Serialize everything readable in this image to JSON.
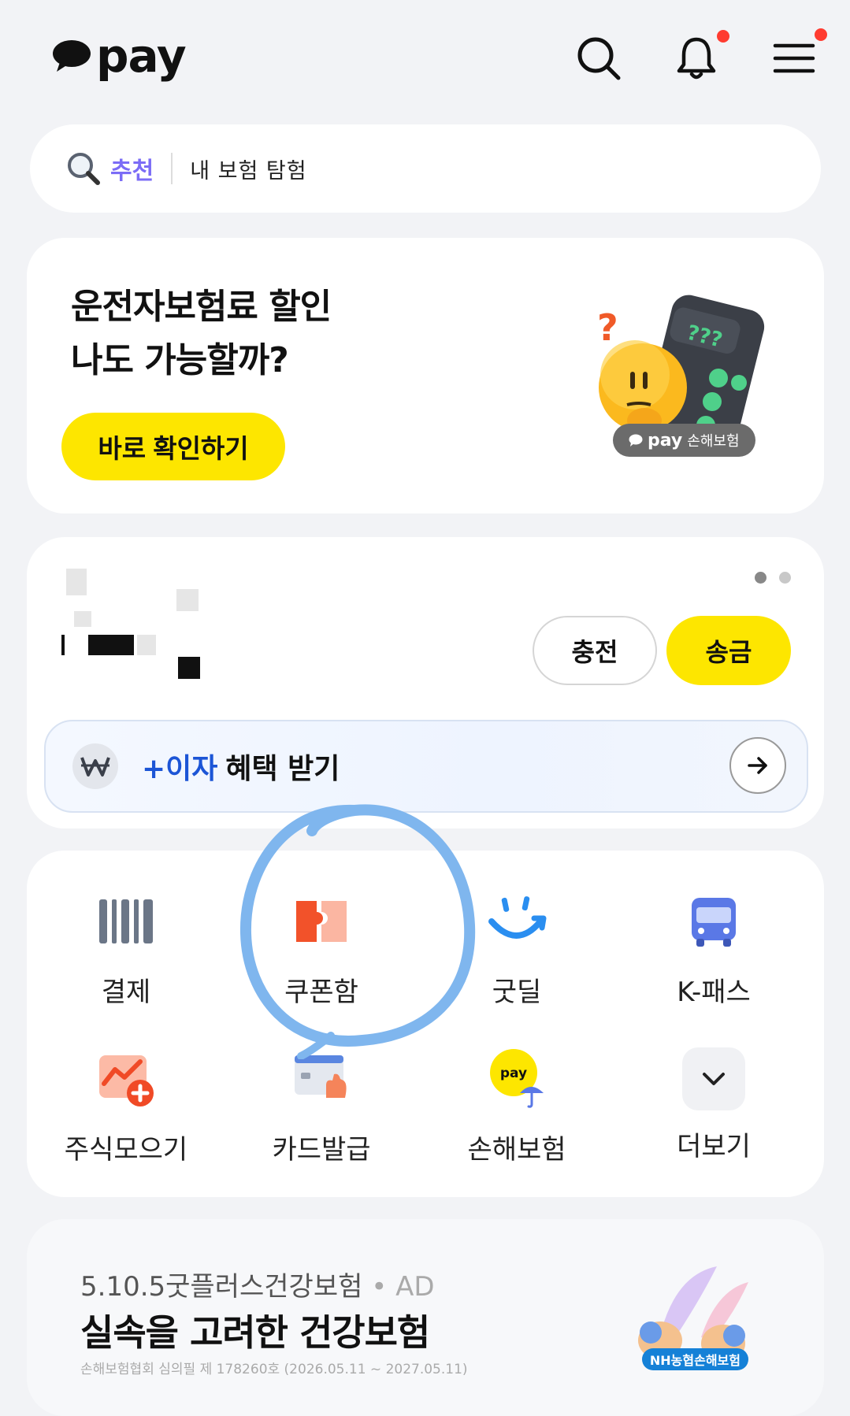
{
  "header": {
    "logo_text": "pay",
    "icons": [
      "search-icon",
      "bell-icon",
      "hamburger-menu-icon"
    ],
    "notification_dot_color": "#ff3b30"
  },
  "search": {
    "tag": "추천",
    "query": "내 보험 탐험"
  },
  "promo": {
    "title_line1": "운전자보험료 할인",
    "title_line2": "나도 가능할까?",
    "button_label": "바로 확인하기",
    "badge_brand": "pay",
    "badge_text": "손해보험",
    "art_text": "???",
    "accent_color": "#fde600"
  },
  "wallet": {
    "charge_label": "충전",
    "send_label": "송금",
    "interest_plus": "+이자",
    "interest_rest": "혜택 받기",
    "page_dots": 2,
    "active_dot": 0
  },
  "menu": {
    "items": [
      {
        "label": "결제",
        "icon": "barcode-icon"
      },
      {
        "label": "쿠폰함",
        "icon": "coupon-icon"
      },
      {
        "label": "굿딜",
        "icon": "smile-deal-icon"
      },
      {
        "label": "K-패스",
        "icon": "bus-icon"
      },
      {
        "label": "주식모으기",
        "icon": "stock-chart-icon"
      },
      {
        "label": "카드발급",
        "icon": "card-issue-icon"
      },
      {
        "label": "손해보험",
        "icon": "pay-insurance-icon"
      },
      {
        "label": "더보기",
        "icon": "chevron-down-icon"
      }
    ]
  },
  "ad": {
    "brand": "5.10.5굿플러스건강보험",
    "ad_tag": "• AD",
    "title": "실속을 고려한 건강보험",
    "sub": "손해보험협회 심의필 제 178260호 (2026.05.11 ~ 2027.05.11)",
    "badge": "NH농협손해보험"
  },
  "annotation": {
    "color": "#7fb6ee"
  }
}
